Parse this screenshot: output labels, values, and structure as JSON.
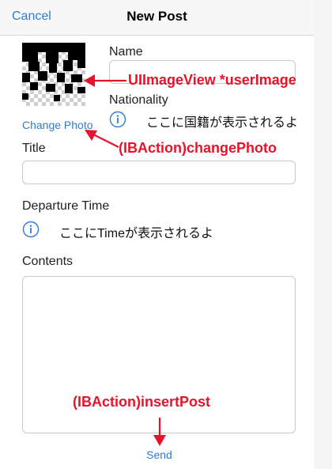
{
  "navbar": {
    "cancel_label": "Cancel",
    "title": "New Post"
  },
  "form": {
    "change_photo_label": "Change Photo",
    "name_label": "Name",
    "name_value": "",
    "nationality_label": "Nationality",
    "nationality_text": "ここに国籍が表示されるよ",
    "title_label": "Title",
    "title_value": "",
    "departure_label": "Departure Time",
    "departure_text": "ここにTimeが表示されるよ",
    "contents_label": "Contents",
    "contents_value": "",
    "send_label": "Send"
  },
  "annotations": {
    "user_image": "UIImageView *userImage",
    "change_photo": "(IBAction)changePhoto",
    "insert_post": "(IBAction)insertPost"
  },
  "icons": {
    "info": "info-circle-icon",
    "avatar_pattern": "pixel-pattern-avatar"
  },
  "colors": {
    "accent": "#2f7bd6",
    "annotation": "#e8132a",
    "navbar_bg": "#f7f7f7"
  }
}
